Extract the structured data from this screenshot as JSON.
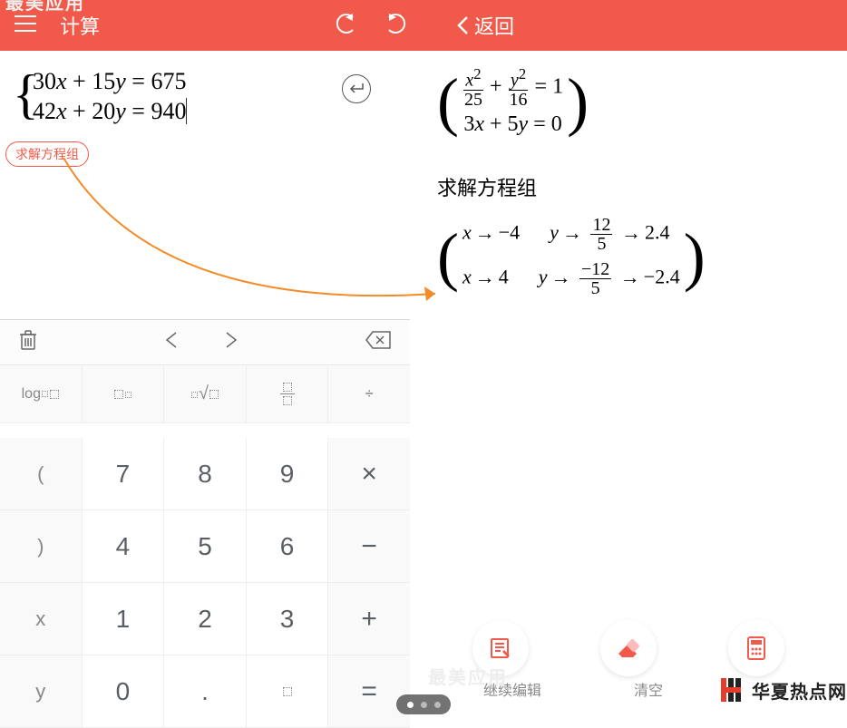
{
  "header": {
    "title": "计算",
    "back_label": "返回"
  },
  "equations_input": {
    "line1_a": "30",
    "line1_x": "x",
    "line1_plus": " + ",
    "line1_b": "15",
    "line1_y": "y",
    "line1_eq": " = ",
    "line1_c": "675",
    "line2_a": "42",
    "line2_x": "x",
    "line2_plus": " + ",
    "line2_b": "20",
    "line2_y": "y",
    "line2_eq": " = ",
    "line2_c": "940"
  },
  "solve_tag": "求解方程组",
  "right": {
    "eq1_frac1_top": "x",
    "eq1_frac1_top_sup": "2",
    "eq1_frac1_bot": "25",
    "eq1_plus": " + ",
    "eq1_frac2_top": "y",
    "eq1_frac2_top_sup": "2",
    "eq1_frac2_bot": "16",
    "eq1_eq": " = ",
    "eq1_rhs": "1",
    "eq2_a": "3",
    "eq2_x": "x",
    "eq2_plus": " + ",
    "eq2_b": "5",
    "eq2_y": "y",
    "eq2_eq": " = ",
    "eq2_rhs": "0",
    "title": "求解方程组",
    "r1_x": "x",
    "r1_xval": "−4",
    "r1_y": "y",
    "r1_frac_top": "12",
    "r1_frac_bot": "5",
    "r1_dec": "2.4",
    "r2_x": "x",
    "r2_xval": "4",
    "r2_y": "y",
    "r2_frac_top": "−12",
    "r2_frac_bot": "5",
    "r2_dec": "−2.4",
    "arrow": "→"
  },
  "keyboard": {
    "log": "log",
    "div": "÷",
    "mul": "×",
    "minus": "−",
    "plus": "+",
    "eq": "=",
    "n7": "7",
    "n8": "8",
    "n9": "9",
    "n4": "4",
    "n5": "5",
    "n6": "6",
    "n1": "1",
    "n2": "2",
    "n3": "3",
    "n0": "0",
    "dot": ".",
    "lparen": "(",
    "rparen": ")",
    "x": "x",
    "y": "y"
  },
  "actions": {
    "edit": "继续编辑",
    "clear": "清空"
  },
  "watermark": "华夏热点网"
}
